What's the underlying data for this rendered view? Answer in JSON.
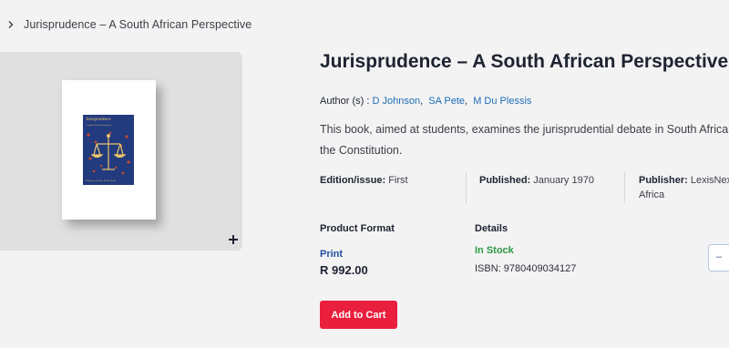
{
  "breadcrumb": {
    "current": "Jurisprudence – A South African Perspective"
  },
  "book": {
    "title": "Jurisprudence – A South African Perspective",
    "cover": {
      "title": "Jurisprudence",
      "subtitle": "A South African Perspective",
      "authors": "D Johnson  SA Pete  M Du Plessis"
    }
  },
  "authors": {
    "label": "Author (s) :",
    "list": [
      "D Johnson",
      "SA Pete",
      "M Du Plessis"
    ],
    "sep": ","
  },
  "description": {
    "line1": "This book, aimed at students, examines the jurisprudential debate in South Africa in the",
    "line2": "the Constitution."
  },
  "meta": {
    "edition_label": "Edition/issue:",
    "edition_value": "First",
    "published_label": "Published:",
    "published_value": "January 1970",
    "publisher_label": "Publisher:",
    "publisher_value_1": "LexisNexis",
    "publisher_value_2": "Africa"
  },
  "product_format": {
    "label": "Product Format",
    "format": "Print",
    "price": "R 992.00"
  },
  "details": {
    "label": "Details",
    "stock": "In Stock",
    "isbn": "ISBN: 9780409034127"
  },
  "quantity": {
    "symbol": "–"
  },
  "cart": {
    "button_label": "Add to Cart"
  },
  "colors": {
    "accent": "#ea1f3d",
    "link": "#1f6db5",
    "stock": "#2d9a43",
    "format": "#1f4e9b"
  },
  "icons": {
    "breadcrumb": "chevron-right-icon",
    "zoom": "plus-icon"
  }
}
